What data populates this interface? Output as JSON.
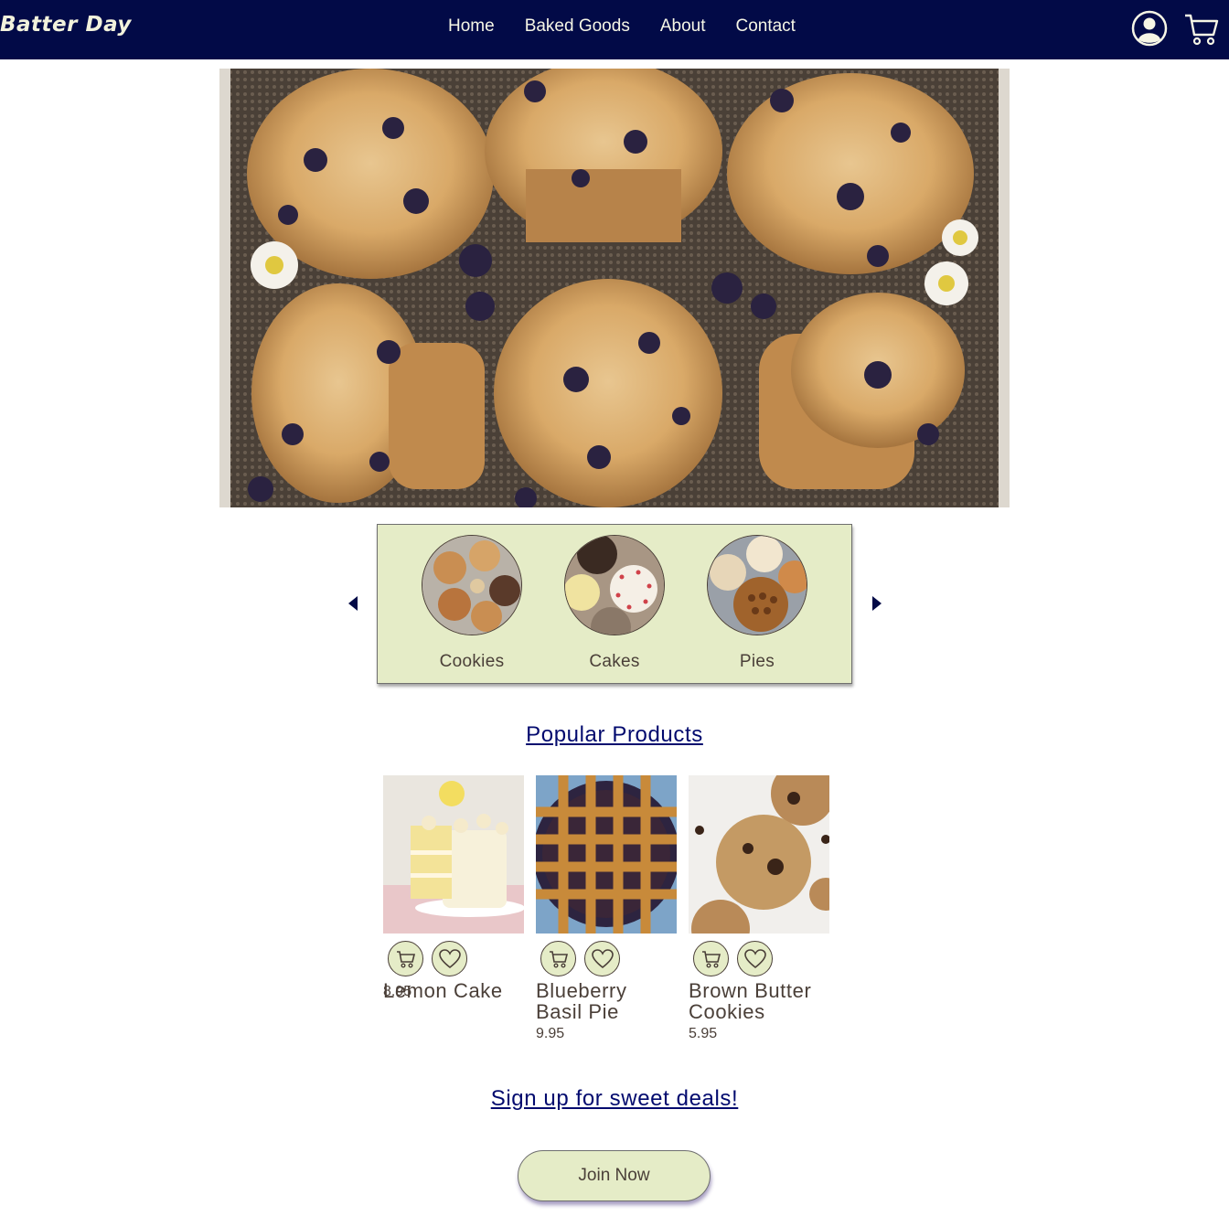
{
  "brand": "Batter Day",
  "nav": {
    "links": [
      "Home",
      "Baked Goods",
      "About",
      "Contact"
    ],
    "icons": [
      "user-account-icon",
      "shopping-cart-icon"
    ]
  },
  "hero": {
    "image": "blueberry-muffins-photo"
  },
  "categories": {
    "items": [
      {
        "label": "Cookies",
        "image": "cookies-photo"
      },
      {
        "label": "Cakes",
        "image": "cakes-photo"
      },
      {
        "label": "Pies",
        "image": "pies-photo"
      }
    ],
    "prev_icon": "caret-left-icon",
    "next_icon": "caret-right-icon"
  },
  "popular": {
    "title": "Popular Products",
    "products": [
      {
        "name_line1": "Lemon Cake",
        "name_line2": "",
        "price": "8.95",
        "image": "lemon-cake-photo"
      },
      {
        "name_line1": "Blueberry",
        "name_line2": "Basil Pie",
        "price": "9.95",
        "image": "blueberry-pie-photo"
      },
      {
        "name_line1": "Brown Butter",
        "name_line2": "Cookies",
        "price": "5.95",
        "image": "brown-butter-cookies-photo"
      }
    ]
  },
  "signup": {
    "title": "Sign up for sweet deals!",
    "button": "Join Now"
  },
  "colors": {
    "nav_bg": "#020a47",
    "accent_bg": "#e5ecc7",
    "heading": "#020a6e",
    "text": "#4a3f38"
  }
}
